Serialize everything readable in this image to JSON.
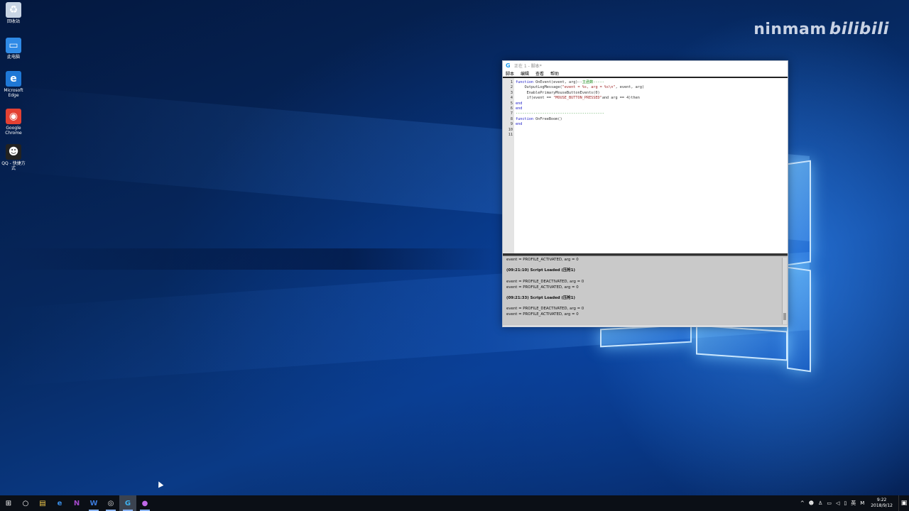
{
  "desktop": {
    "icons": [
      {
        "label": "回收站",
        "glyph": "♻",
        "color": "#c8d4e4"
      },
      {
        "label": "此电脑",
        "glyph": "▭",
        "color": "#2f8ae6"
      },
      {
        "label": "Microsoft Edge",
        "glyph": "e",
        "color": "#1f78d6"
      },
      {
        "label": "Google Chrome",
        "glyph": "◉",
        "color": "#e34133"
      },
      {
        "label": "QQ - 快捷方式",
        "glyph": "☻",
        "color": "#222"
      }
    ]
  },
  "watermark": {
    "user": "ninmam",
    "brand": "bilibili"
  },
  "editor": {
    "title": "正在 1 - 脚本*",
    "menu": [
      "脚本",
      "编辑",
      "查看",
      "帮助"
    ],
    "line_numbers": [
      "1",
      "2",
      "3",
      "4",
      "5",
      "6",
      "7",
      "8",
      "9",
      "10",
      "11"
    ],
    "code": {
      "l1_kw": "function",
      "l1_rest": " OnEvent(event, arg)--",
      "l1_cmt": "主函数",
      "l1_tail": "-----",
      "l2_fn": "    OutputLogMessage(",
      "l2_str": "\"event = %s, arg = %s\\n\"",
      "l2_tail": ", event, arg)",
      "l3": "     EnablePrimaryMouseButtonEvents(0)",
      "l4_pre": "     if(event == ",
      "l4_str": "\"MOUSE_BUTTON_PRESSED\"",
      "l4_tail": "and arg == 4)then",
      "l5": "",
      "l6": "end",
      "l7": "end",
      "l8": "----------------------------------------",
      "l9_kw": "function",
      "l9_rest": " OnFreeBoom()",
      "l10": "",
      "l11": "end"
    },
    "console": [
      {
        "text": "event = PROFILE_ACTIVATED, arg = 0",
        "bold": false
      },
      {
        "text": "",
        "bold": false
      },
      {
        "text": "(09:21:10) Script Loaded (压枪1)",
        "bold": true
      },
      {
        "text": "",
        "bold": false
      },
      {
        "text": "event = PROFILE_DEACTIVATED, arg = 0",
        "bold": false
      },
      {
        "text": "event = PROFILE_ACTIVATED, arg = 0",
        "bold": false
      },
      {
        "text": "",
        "bold": false
      },
      {
        "text": "(09:21:33) Script Loaded (压枪1)",
        "bold": true
      },
      {
        "text": "",
        "bold": false
      },
      {
        "text": "event = PROFILE_DEACTIVATED, arg = 0",
        "bold": false
      },
      {
        "text": "event = PROFILE_ACTIVATED, arg = 0",
        "bold": false
      }
    ]
  },
  "taskbar": {
    "start_glyph": "⊞",
    "search_glyph": "○",
    "apps": [
      {
        "name": "file-explorer",
        "glyph": "▤",
        "color": "#f2c94c",
        "running": false,
        "active": false
      },
      {
        "name": "edge",
        "glyph": "e",
        "color": "#3a8ee6",
        "running": false,
        "active": false
      },
      {
        "name": "onenote",
        "glyph": "N",
        "color": "#a349c9",
        "running": false,
        "active": false
      },
      {
        "name": "word",
        "glyph": "W",
        "color": "#3b78d8",
        "running": true,
        "active": false
      },
      {
        "name": "obs",
        "glyph": "◎",
        "color": "#ddd",
        "running": true,
        "active": false
      },
      {
        "name": "logitech",
        "glyph": "G",
        "color": "#3fb2f0",
        "running": true,
        "active": true
      },
      {
        "name": "maps",
        "glyph": "●",
        "color": "#c069e8",
        "running": true,
        "active": false
      }
    ],
    "tray": {
      "chevron": "^",
      "ime_lang": "英",
      "ime_mode": "M",
      "time": "9:22",
      "date": "2018/9/12"
    }
  }
}
